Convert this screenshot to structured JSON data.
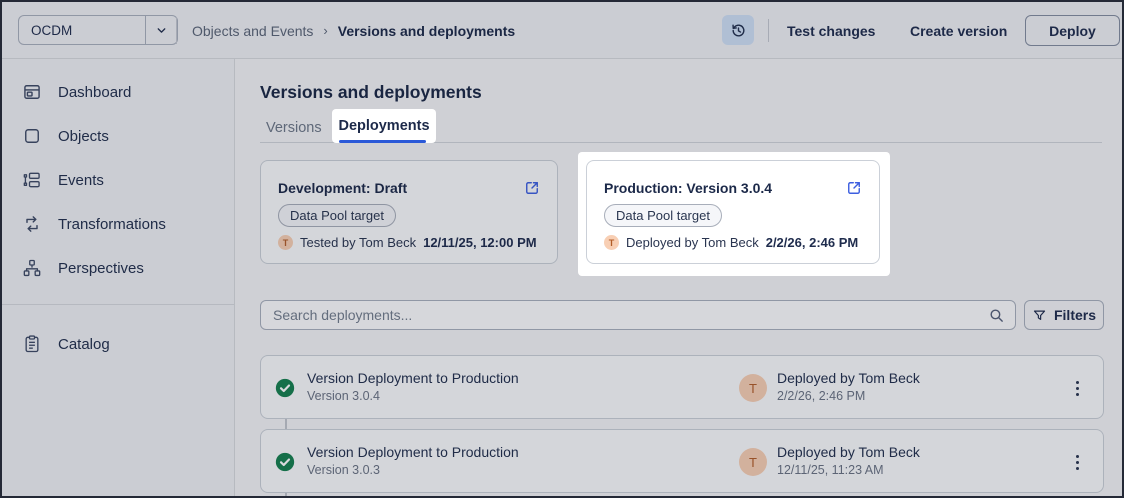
{
  "topbar": {
    "model_selector": {
      "value": "OCDM",
      "icon": "chevron-down-icon"
    },
    "breadcrumb": {
      "items": [
        "Objects and Events",
        "Versions and deployments"
      ],
      "separator": "›"
    },
    "history_button_icon": "history-clock-icon",
    "actions": {
      "test_changes": "Test changes",
      "create_version": "Create version",
      "deploy": "Deploy"
    }
  },
  "sidebar": {
    "items": [
      {
        "label": "Dashboard",
        "icon": "dashboard-icon"
      },
      {
        "label": "Objects",
        "icon": "objects-icon"
      },
      {
        "label": "Events",
        "icon": "events-icon"
      },
      {
        "label": "Transformations",
        "icon": "transformations-icon"
      },
      {
        "label": "Perspectives",
        "icon": "perspectives-icon"
      }
    ],
    "footer_items": [
      {
        "label": "Catalog",
        "icon": "catalog-icon"
      }
    ]
  },
  "main": {
    "title": "Versions and deployments",
    "tabs": [
      {
        "label": "Versions",
        "active": false
      },
      {
        "label": "Deployments",
        "active": true,
        "spotlighted": true
      }
    ],
    "cards": [
      {
        "title": "Development: Draft",
        "chip": "Data Pool target",
        "avatar_initial": "T",
        "meta_prefix": "Tested by Tom Beck",
        "meta_time": "12/11/25, 12:00 PM",
        "icon": "external-link-icon",
        "spotlighted": false
      },
      {
        "title": "Production: Version 3.0.4",
        "chip": "Data Pool target",
        "avatar_initial": "T",
        "meta_prefix": "Deployed by Tom Beck",
        "meta_time": "2/2/26, 2:46 PM",
        "icon": "external-link-icon",
        "spotlighted": true
      }
    ],
    "search": {
      "placeholder": "Search deployments...",
      "icon": "search-icon"
    },
    "filters": {
      "label": "Filters",
      "icon": "filter-funnel-icon"
    },
    "deployments": [
      {
        "title": "Version Deployment to Production",
        "subtitle": "Version 3.0.4",
        "status": "success",
        "status_icon": "check-circle-icon",
        "avatar_initial": "T",
        "by": "Deployed by Tom Beck",
        "time": "2/2/26, 2:46 PM",
        "menu_icon": "kebab-menu-icon"
      },
      {
        "title": "Version Deployment to Production",
        "subtitle": "Version 3.0.3",
        "status": "success",
        "status_icon": "check-circle-icon",
        "avatar_initial": "T",
        "by": "Deployed by Tom Beck",
        "time": "12/11/25, 11:23 AM",
        "menu_icon": "kebab-menu-icon"
      }
    ]
  },
  "colors": {
    "accent_blue": "#2b59d8",
    "link_blue": "#3d5fe0",
    "success_green": "#15804f",
    "avatar_bg": "#f8cfb4",
    "avatar_text": "#b25d28",
    "spotlight_white": "#ffffff",
    "text_navy": "#1f2c4d"
  }
}
